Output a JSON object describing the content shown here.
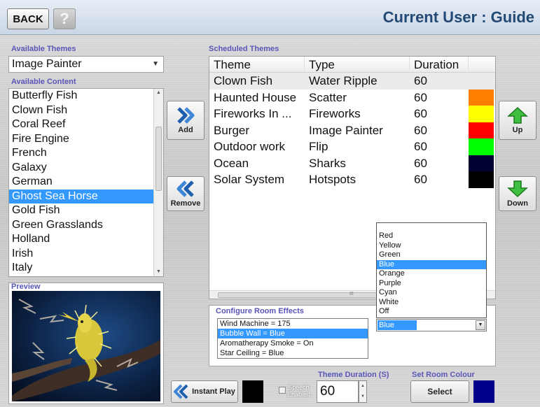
{
  "header": {
    "back_label": "BACK",
    "help_label": "?",
    "user_title": "Current User : Guide"
  },
  "labels": {
    "available_themes": "Available Themes",
    "available_content": "Available Content",
    "preview": "Preview",
    "scheduled_themes": "Scheduled Themes",
    "configure_room_effects": "Configure Room Effects",
    "theme_duration": "Theme Duration (S)",
    "set_room_colour": "Set Room Colour"
  },
  "themes_combo": {
    "value": "Image Painter"
  },
  "content_list": {
    "items": [
      "Butterfly Fish",
      "Clown Fish",
      "Coral Reef",
      "Fire Engine",
      "French",
      "Galaxy",
      "German",
      "Ghost Sea Horse",
      "Gold Fish",
      "Green Grasslands",
      "Holland",
      "Irish",
      "Italy"
    ],
    "selected": "Ghost Sea Horse"
  },
  "buttons": {
    "add": "Add",
    "remove": "Remove",
    "up": "Up",
    "down": "Down",
    "instant_play": "Instant Play",
    "select": "Select"
  },
  "scheduled": {
    "columns": [
      "Theme",
      "Type",
      "Duration"
    ],
    "rows": [
      {
        "theme": "Clown Fish",
        "type": "Water Ripple",
        "duration": "60",
        "color": ""
      },
      {
        "theme": "Haunted House",
        "type": "Scatter",
        "duration": "60",
        "color": "#ff8000"
      },
      {
        "theme": "Fireworks In ...",
        "type": "Fireworks",
        "duration": "60",
        "color": "#ffff00"
      },
      {
        "theme": "Burger",
        "type": "Image Painter",
        "duration": "60",
        "color": "#ff0000"
      },
      {
        "theme": "Outdoor work",
        "type": "Flip",
        "duration": "60",
        "color": "#00ff00"
      },
      {
        "theme": "Ocean",
        "type": "Sharks",
        "duration": "60",
        "color": "#000033"
      },
      {
        "theme": "Solar System",
        "type": "Hotspots",
        "duration": "60",
        "color": "#000000"
      }
    ],
    "scroll_marker": "III"
  },
  "color_dropdown": {
    "options": [
      "Red",
      "Yellow",
      "Green",
      "Blue",
      "Orange",
      "Purple",
      "Cyan",
      "White",
      "Off"
    ],
    "selected": "Blue"
  },
  "room_effects": {
    "items": [
      "Wind Machine = 175",
      "Bubble Wall = Blue",
      "Aromatherapy Smoke = On",
      "Star Ceiling = Blue"
    ],
    "selected": "Bubble Wall = Blue"
  },
  "speech": {
    "label_line1": "Speech",
    "label_line2": "Enabled",
    "checked": false
  },
  "duration": {
    "value": "60"
  },
  "colors": {
    "accent": "#3399ff",
    "title": "#234a74",
    "section_label": "#5a56b8",
    "room_colour": "#00008b",
    "instant_colour": "#000000"
  }
}
